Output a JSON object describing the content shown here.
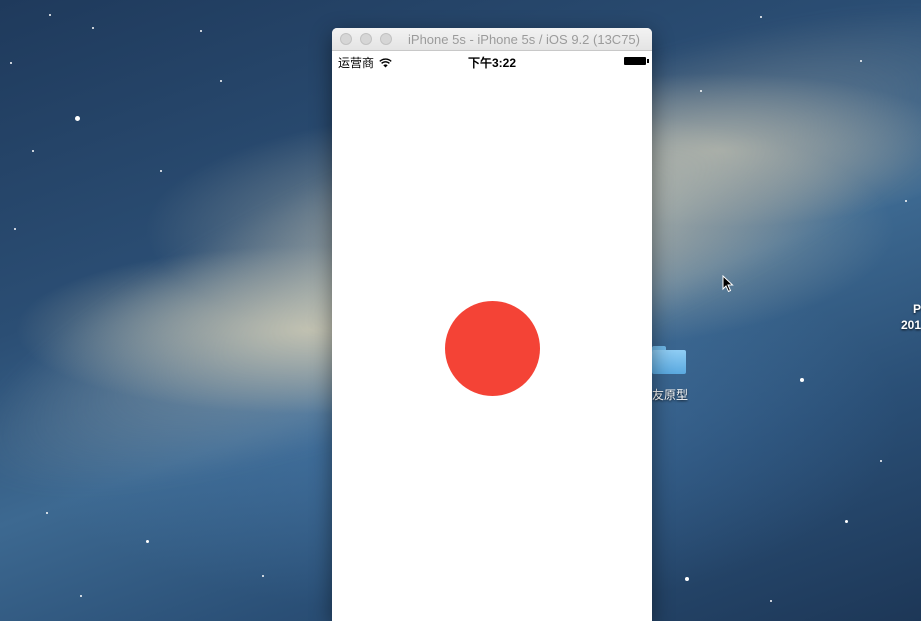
{
  "simulator": {
    "window_title": "iPhone 5s - iPhone 5s / iOS 9.2 (13C75)",
    "status_bar": {
      "carrier": "运营商",
      "time": "下午3:22"
    },
    "screen": {
      "background_color": "#ffffff",
      "circle_color": "#f44336"
    }
  },
  "desktop": {
    "folder_label": "友原型",
    "cutoff_label_line1": "P",
    "cutoff_label_line2": "201"
  }
}
